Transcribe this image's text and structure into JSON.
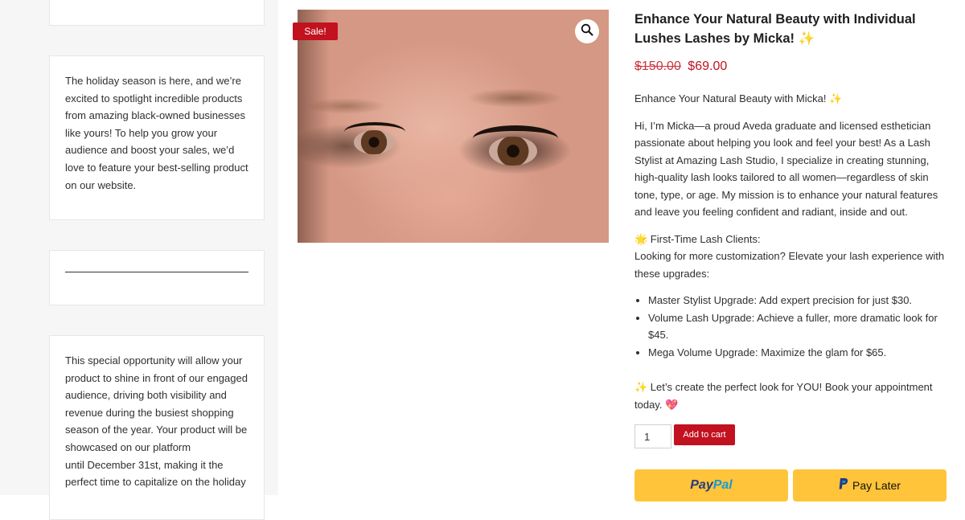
{
  "sidebar": {
    "card2_text": "The holiday season is here, and we’re excited to spotlight incredible products from amazing black-owned businesses like yours! To help you grow your audience and boost your sales, we’d love to feature your best-selling product on our website.",
    "card4_text_1": "This special opportunity will allow your product to shine in front of our engaged audience, driving both visibility and revenue during the busiest shopping season of the year. Your product will be showcased on our platform",
    "card4_text_2": "until December 31st, making it the perfect time to capitalize on the holiday"
  },
  "product": {
    "sale_badge": "Sale!",
    "zoom_icon": "magnifier-icon",
    "title": "Enhance Your Natural Beauty with Individual Lushes Lashes by Micka! ✨",
    "old_price": "$150.00",
    "new_price": "$69.00",
    "intro": "Enhance Your Natural Beauty with Micka! ✨",
    "bio": "Hi, I’m Micka—a proud Aveda graduate and licensed esthetician passionate about helping you look and feel your best! As a Lash Stylist at Amazing Lash Studio, I specialize in creating stunning, high-quality lash looks tailored to all women—regardless of skin tone, type, or age. My mission is to enhance your natural features and leave you feeling confident and radiant, inside and out.",
    "first_time_heading": "🌟 First-Time Lash Clients:",
    "first_time_text": "Looking for more customization? Elevate your lash experience with these upgrades:",
    "upgrades": [
      "Master Stylist Upgrade: Add expert precision for just $30.",
      "Volume Lash Upgrade: Achieve a fuller, more dramatic look for $45.",
      "Mega Volume Upgrade: Maximize the glam for $65."
    ],
    "cta": "✨ Let’s create the perfect look for YOU! Book your appointment today. 💖",
    "quantity": "1",
    "add_to_cart": "Add to cart",
    "paypal_pay": "Pay",
    "paypal_pal": "Pal",
    "pay_later": "Pay Later"
  },
  "colors": {
    "accent": "#c2111f",
    "paypal_yellow": "#ffc439",
    "paypal_dark_blue": "#253b80",
    "paypal_light_blue": "#179bd7"
  }
}
